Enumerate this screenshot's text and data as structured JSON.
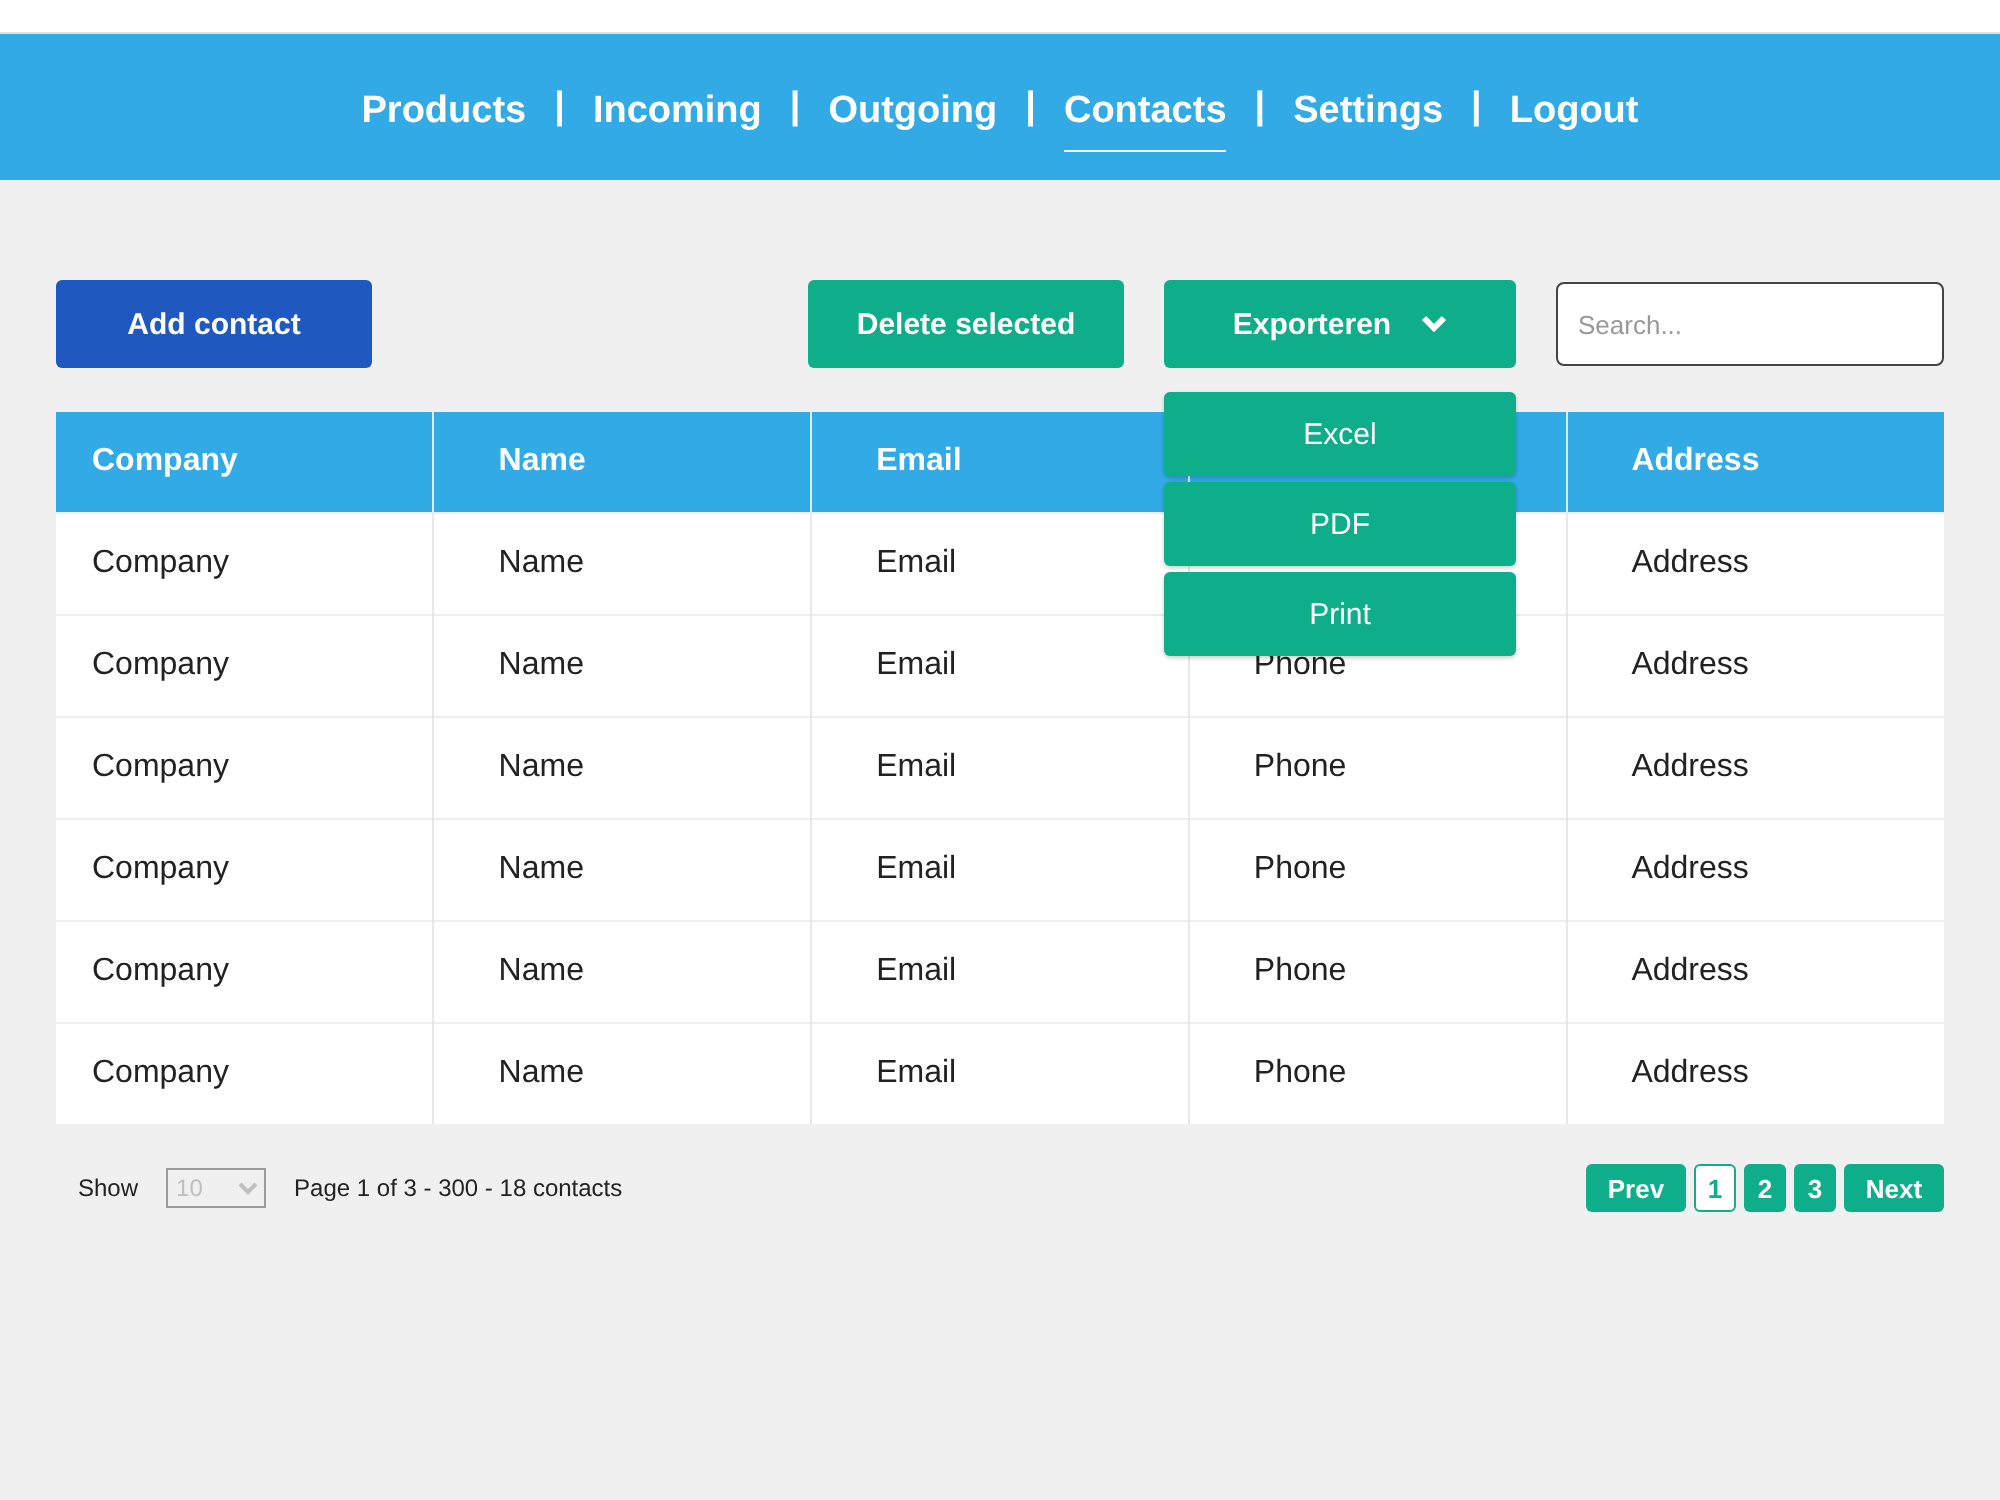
{
  "nav": [
    {
      "label": "Products",
      "selected": false
    },
    {
      "label": "Incoming",
      "selected": false
    },
    {
      "label": "Outgoing",
      "selected": false
    },
    {
      "label": "Contacts",
      "selected": true
    },
    {
      "label": "Settings",
      "selected": false
    },
    {
      "label": "Logout",
      "selected": false
    }
  ],
  "nav_separator": "|",
  "toolbar": {
    "add_button": "Add contact",
    "delete_button": "Delete selected",
    "export_button": "Exporteren",
    "search": {
      "placeholder": "Search..."
    }
  },
  "export_menu": {
    "expanded": true,
    "items": [
      "Excel",
      "PDF",
      "Print"
    ]
  },
  "table": {
    "header": {
      "column_1": "Company",
      "column_2": "Name",
      "column_3": "Email",
      "column_5": "Address"
    },
    "rows": [
      {
        "column_1": "Company",
        "column_2": "Name",
        "column_3": "Email",
        "column_5": "Address"
      },
      {
        "column_1": "Company",
        "column_2": "Name",
        "column_3": "Email",
        "column_4": "Phone",
        "column_5": "Address"
      },
      {
        "column_1": "Company",
        "column_2": "Name",
        "column_3": "Email",
        "column_4": "Phone",
        "column_5": "Address"
      },
      {
        "column_1": "Company",
        "column_2": "Name",
        "column_3": "Email",
        "column_4": "Phone",
        "column_5": "Address"
      },
      {
        "column_1": "Company",
        "column_2": "Name",
        "column_3": "Email",
        "column_4": "Phone",
        "column_5": "Address"
      },
      {
        "column_1": "Company",
        "column_2": "Name",
        "column_3": "Email",
        "column_4": "Phone",
        "column_5": "Address"
      }
    ]
  },
  "footer": {
    "show_label": "Show",
    "page_size": "10",
    "page_size_disabled": true,
    "summary": "Page 1 of 3 - 300 - 18 contacts",
    "prev": "Prev",
    "next": "Next",
    "pages": [
      {
        "label": "1",
        "selected": true
      },
      {
        "label": "2",
        "selected": false
      },
      {
        "label": "3",
        "selected": false
      }
    ]
  }
}
